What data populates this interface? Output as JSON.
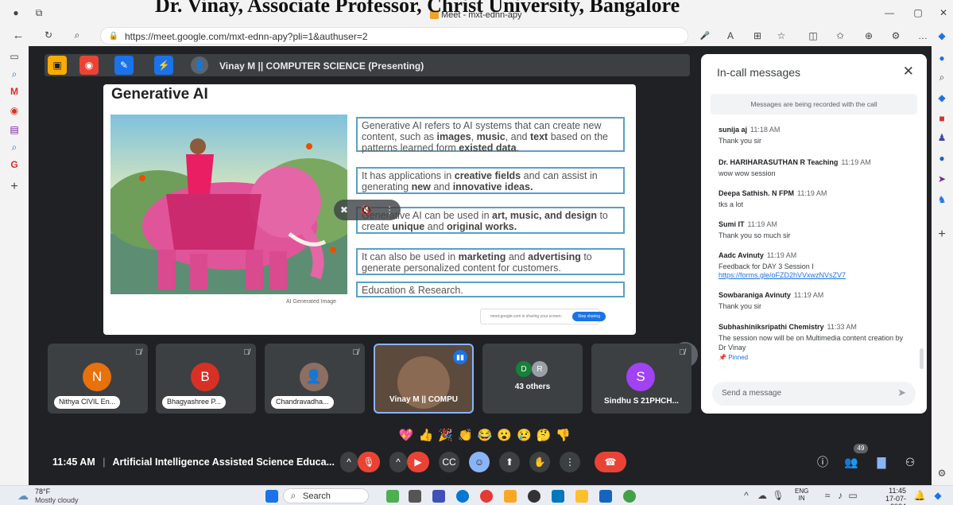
{
  "overlay_title": "Dr. Vinay, Associate Professor, Christ University, Bangalore",
  "browser": {
    "tab_title": "Meet - mxt-ednn-apy",
    "url": "https://meet.google.com/mxt-ednn-apy?pli=1&authuser=2"
  },
  "presenting": {
    "presenter_label": "Vinay M || COMPUTER SCIENCE (Presenting)"
  },
  "slide": {
    "title": "Generative AI",
    "image_caption": "AI Generated Image",
    "box1_a": "Generative AI refers to AI systems that can create new content, such as ",
    "box1_b": "images",
    "box1_c": ", ",
    "box1_d": "music",
    "box1_e": ", and ",
    "box1_f": "text",
    "box1_g": " based on the patterns learned form ",
    "box1_h": "existed data",
    "box1_i": ".",
    "box2_a": "It has applications in ",
    "box2_b": "creative fields",
    "box2_c": " and can assist in generating ",
    "box2_d": "new",
    "box2_e": " and ",
    "box2_f": "innovative ideas.",
    "box3_a": "Generative AI can be used in ",
    "box3_b": "art, music, and design",
    "box3_c": " to create ",
    "box3_d": "unique",
    "box3_e": " and ",
    "box3_f": "original works.",
    "box4_a": "It can also be used in ",
    "box4_b": "marketing",
    "box4_c": " and ",
    "box4_d": "advertising",
    "box4_e": " to generate personalized content for customers.",
    "box5": "Education & Research.",
    "share_notice": "meet.google.com is sharing your screen.",
    "stop_sharing": "Stop sharing"
  },
  "tiles": [
    {
      "initial": "N",
      "name": "Nithya CIVIL En...",
      "color": "#e8710a"
    },
    {
      "initial": "B",
      "name": "Bhagyashree P...",
      "color": "#d93025"
    },
    {
      "initial": "",
      "name": "Chandravadha...",
      "color": "#8d6e63"
    },
    {
      "initial": "",
      "name": "Vinay M || COMPU",
      "color": "#5f6368"
    },
    {
      "initial": "D R",
      "name": "43 others",
      "color": "#5f6368"
    },
    {
      "initial": "S",
      "name": "Sindhu S 21PHCH...",
      "color": "#a142f4"
    }
  ],
  "reactions": [
    "💖",
    "👍",
    "🎉",
    "👏",
    "😂",
    "😮",
    "😢",
    "🤔",
    "👎"
  ],
  "bottom": {
    "time": "11:45 AM",
    "separator": "|",
    "meeting_title": "Artificial Intelligence Assisted Science Educa...",
    "participant_count": "49"
  },
  "chat": {
    "title": "In-call messages",
    "banner": "Messages are being recorded with the call",
    "messages": [
      {
        "sender": "sunija aj",
        "time": "11:18 AM",
        "text": "Thank you sir"
      },
      {
        "sender": "Dr. HARIHARASUTHAN R Teaching",
        "time": "11:19 AM",
        "text": "wow wow session"
      },
      {
        "sender": "Deepa Sathish. N FPM",
        "time": "11:19 AM",
        "text": "tks a lot"
      },
      {
        "sender": "Sumi IT",
        "time": "11:19 AM",
        "text": "Thank you so much sir"
      },
      {
        "sender": "Aadc Avinuty",
        "time": "11:19 AM",
        "text": "Feedback for DAY 3 Session I",
        "link": "https://forms.gle/oFZD2hVVxwzNVsZV7"
      },
      {
        "sender": "Sowbaraniga Avinuty",
        "time": "11:19 AM",
        "text": "Thank you sir"
      },
      {
        "sender": "Subhashiniksripathi Chemistry",
        "time": "11:33 AM",
        "text": "The session now will be on Multimedia content creation by Dr Vinay",
        "pinned": "Pinned"
      }
    ],
    "input_placeholder": "Send a message"
  },
  "taskbar": {
    "weather_temp": "78°F",
    "weather_text": "Mostly cloudy",
    "search": "Search",
    "lang": "ENG",
    "lang_sub": "IN",
    "clock_time": "11:45",
    "clock_date": "17-07-2024"
  }
}
